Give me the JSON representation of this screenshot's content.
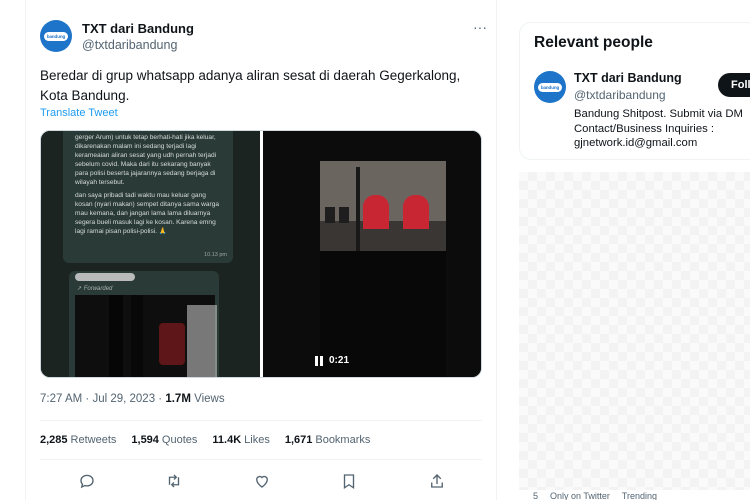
{
  "tweet": {
    "author_name": "TXT dari Bandung",
    "author_handle": "@txtdaribandung",
    "avatar_text": "bandung",
    "text": "Beredar di grup whatsapp adanya aliran sesat di daerah Gegerkalong, Kota Bandung.",
    "translate_label": "Translate Tweet",
    "media": {
      "chat_paragraphs": [
        "gerger Arum) untuk tetap berhati-hati jika keluar, dikarenakan malam ini sedang terjadi lagi kerameaian aliran sesat yang udh pernah terjadi sebelum covid. Maka dari itu sekarang banyak para polisi beserta jajarannya sedang berjaga di wilayah tersebut.",
        "dan saya pribadi tadi waktu mau keluar gang kosan (nyari makan) sempet ditanya sama warga mau kemana, dan jangan lama lama diluarnya segera bueli masuk lagi ke kosan. Karena emng lagi ramai pisan polisi-polisi. 🙏"
      ],
      "chat_time": "10.13 pm",
      "forwarded_label": "Forwarded",
      "video_time": "0:21"
    },
    "time": "7:27 AM",
    "date": "Jul 29, 2023",
    "views_count": "1.7M",
    "views_label": "Views",
    "stats": {
      "retweets_count": "2,285",
      "retweets_label": "Retweets",
      "quotes_count": "1,594",
      "quotes_label": "Quotes",
      "likes_count": "11.4K",
      "likes_label": "Likes",
      "bookmarks_count": "1,671",
      "bookmarks_label": "Bookmarks"
    },
    "actions": [
      "reply-icon",
      "retweet-icon",
      "like-icon",
      "bookmark-icon",
      "share-icon"
    ]
  },
  "sidebar": {
    "relevant_title": "Relevant people",
    "person": {
      "name": "TXT dari Bandung",
      "handle": "@txtdaribandung",
      "bio": "Bandung Shitpost. Submit via DM Contact/Business Inquiries : gjnetwork.id@gmail.com",
      "follow_label": "Follow"
    },
    "footer_items": [
      "5",
      "Only on Twitter",
      "Trending"
    ]
  },
  "colors": {
    "accent": "#1d9bf0",
    "avatar_bg": "#1d74c9",
    "text_primary": "#0f1419",
    "text_secondary": "#536471"
  }
}
